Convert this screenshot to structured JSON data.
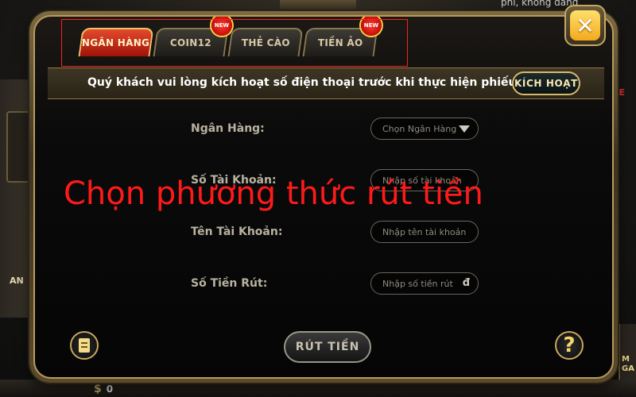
{
  "background": {
    "top_right_text": "phí, không đăng",
    "left_text": "AN",
    "right_text": "VE",
    "right_bottom_text_1": "M",
    "right_bottom_text_2": "GA",
    "coin_symbol": "$",
    "coin_value": "0"
  },
  "tabs": [
    {
      "label": "NGÂN HÀNG",
      "active": true,
      "badge": ""
    },
    {
      "label": "COIN12",
      "active": false,
      "badge": "NEW"
    },
    {
      "label": "THẺ CÀO",
      "active": false,
      "badge": ""
    },
    {
      "label": "TIỀN ẢO",
      "active": false,
      "badge": "NEW"
    }
  ],
  "close_glyph": "✕",
  "notice": {
    "text": "Quý khách vui lòng kích hoạt số điện thoại trước khi thực hiện phiếu rút",
    "button": "KÍCH HOẠT"
  },
  "form": {
    "bank_label": "Ngân Hàng:",
    "bank_select": "Chọn Ngân Hàng",
    "account_number_label": "Số Tài Khoản:",
    "account_number_placeholder": "Nhập số tài khoản",
    "account_name_label": "Tên Tài Khoản:",
    "account_name_placeholder": "Nhập tên tài khoản",
    "amount_label": "Số Tiền Rút:",
    "amount_placeholder": "Nhập số tiền rút",
    "currency_symbol": "đ"
  },
  "annotation_text": "Chọn phương thức rút tiền",
  "withdraw_button": "RÚT TIỀN",
  "help_glyph": "?",
  "colors": {
    "accent_gold": "#c9a75f",
    "active_tab": "#d8321b",
    "annotation_red": "#ff1a1a"
  }
}
